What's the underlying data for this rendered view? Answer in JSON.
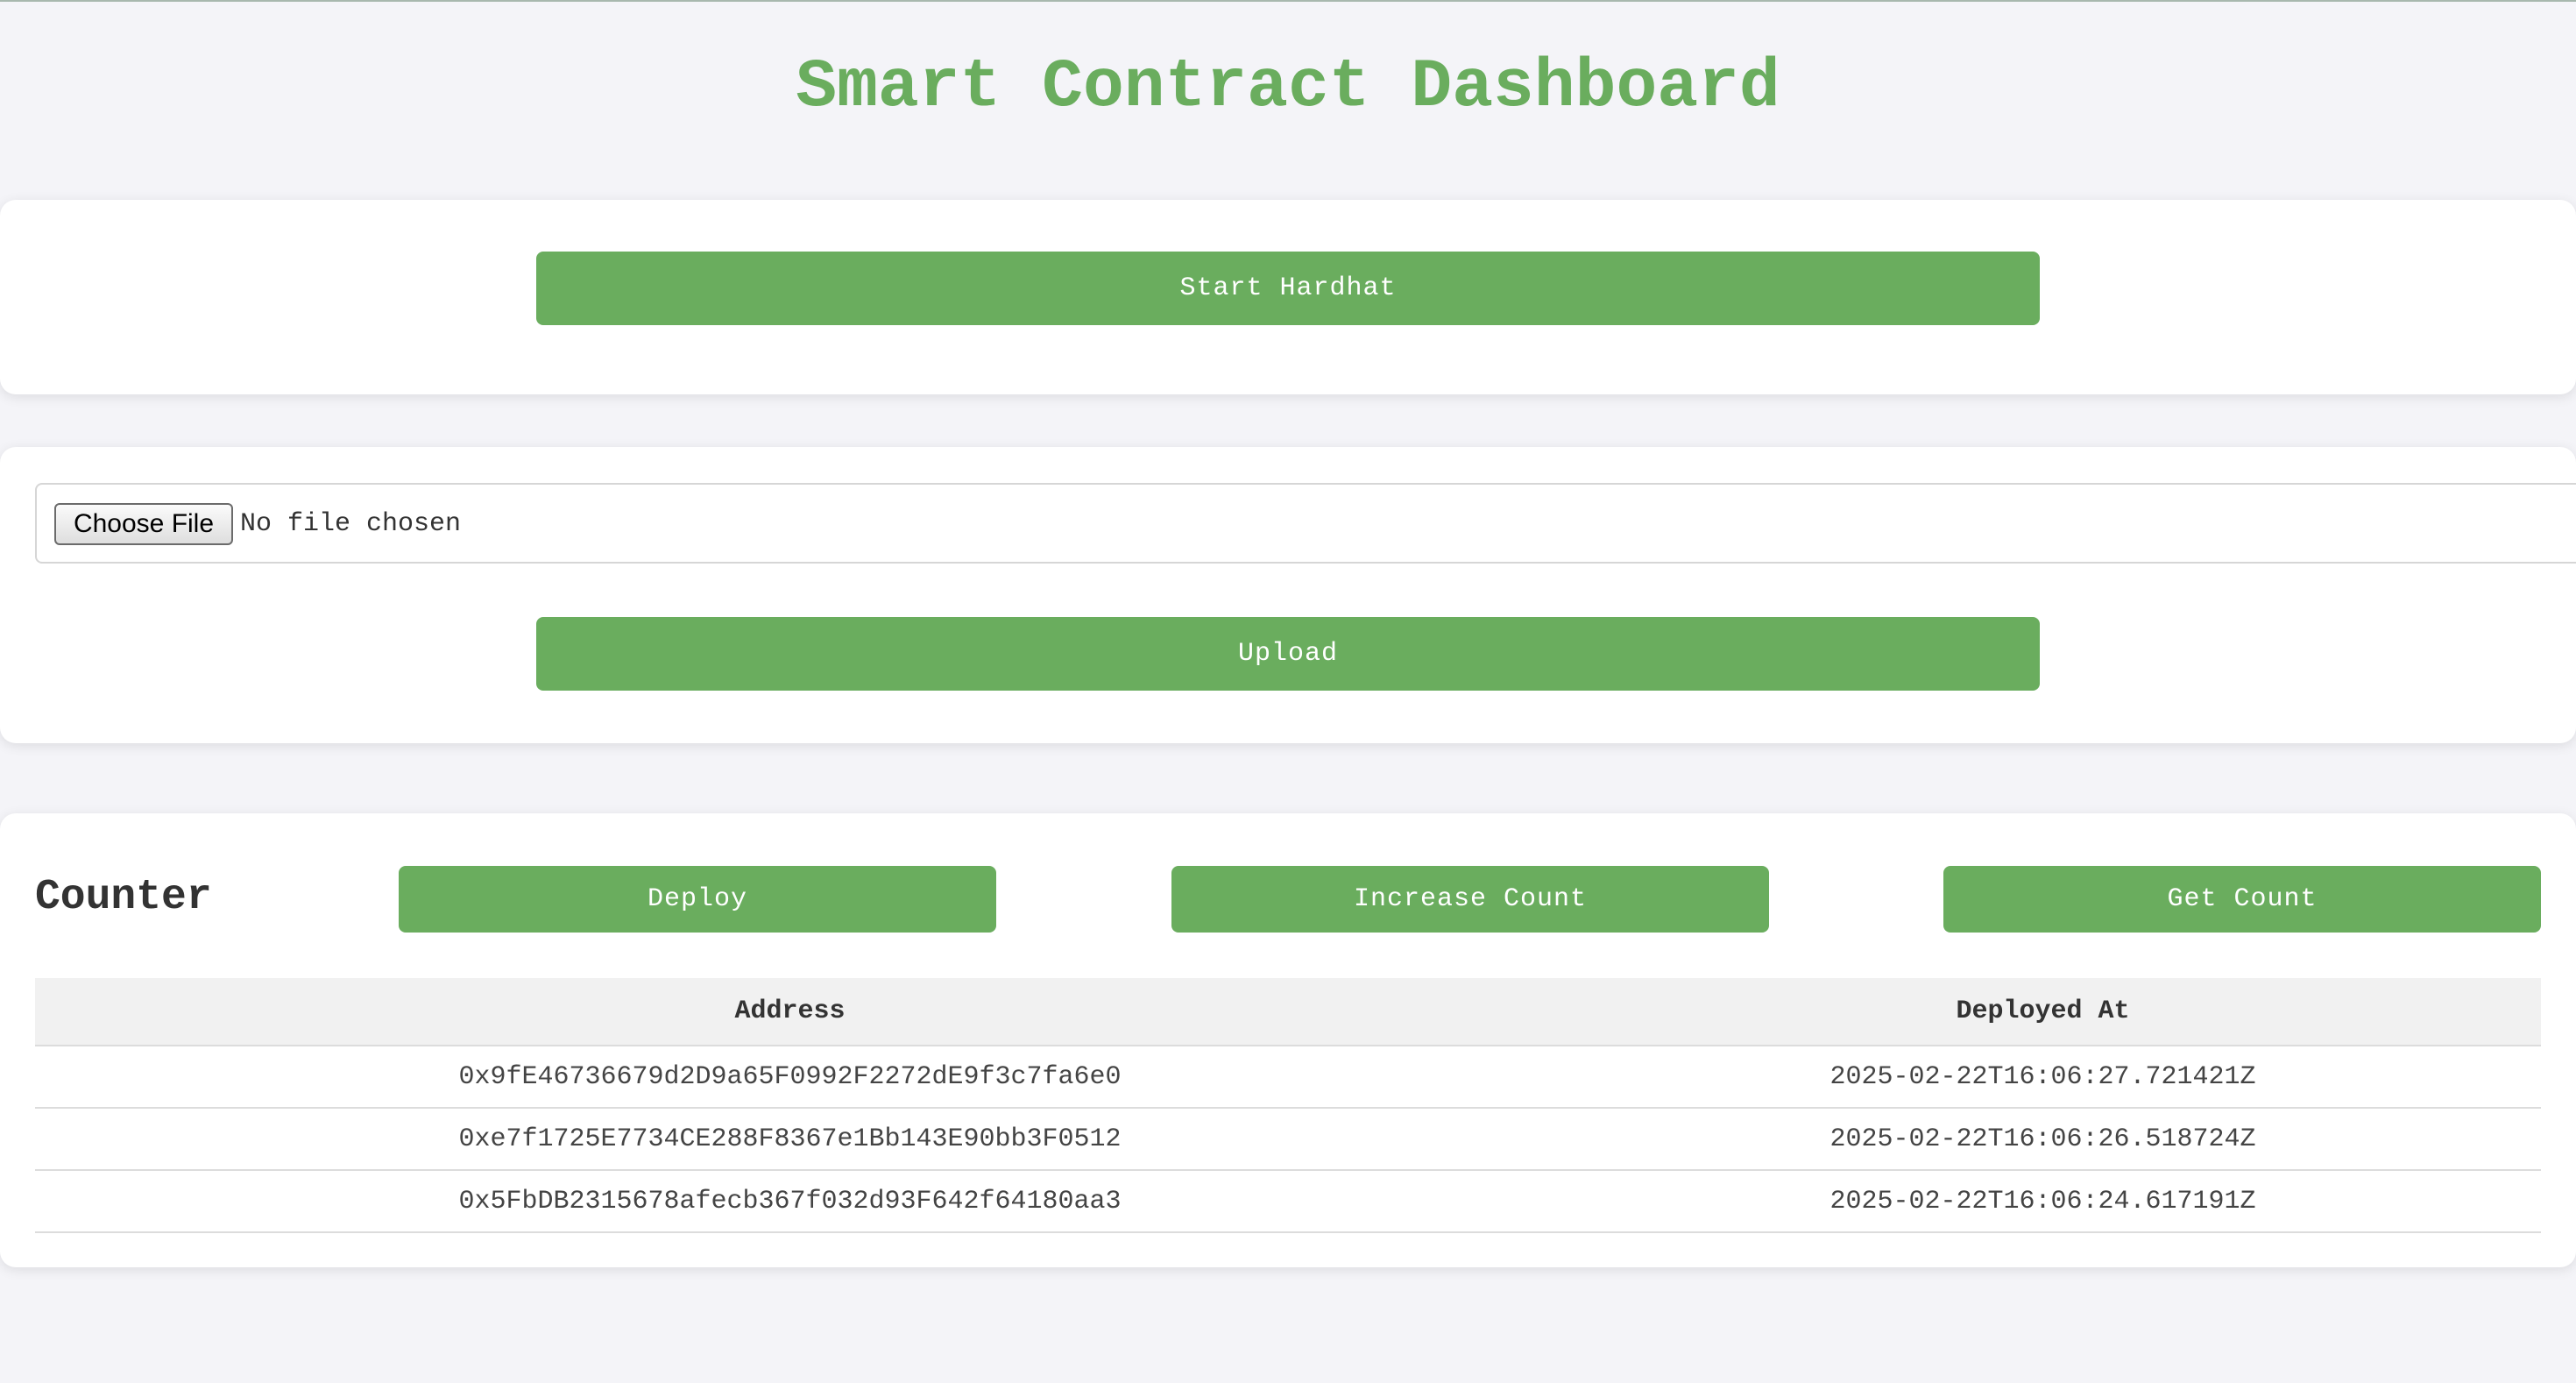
{
  "page": {
    "title": "Smart Contract Dashboard"
  },
  "hardhat": {
    "start_label": "Start Hardhat"
  },
  "upload": {
    "choose_file_label": "Choose File",
    "file_status": "No file chosen",
    "upload_label": "Upload"
  },
  "contract": {
    "name": "Counter",
    "deploy_label": "Deploy",
    "increase_label": "Increase Count",
    "get_count_label": "Get Count",
    "table": {
      "headers": [
        "Address",
        "Deployed At"
      ],
      "rows": [
        {
          "address": "0x9fE46736679d2D9a65F0992F2272dE9f3c7fa6e0",
          "deployed_at": "2025-02-22T16:06:27.721421Z"
        },
        {
          "address": "0xe7f1725E7734CE288F8367e1Bb143E90bb3F0512",
          "deployed_at": "2025-02-22T16:06:26.518724Z"
        },
        {
          "address": "0x5FbDB2315678afecb367f032d93F642f64180aa3",
          "deployed_at": "2025-02-22T16:06:24.617191Z"
        }
      ]
    }
  },
  "colors": {
    "accent": "#6aad5e",
    "background": "#f4f4f8",
    "card": "#ffffff",
    "table_header": "#f1f1f1"
  }
}
